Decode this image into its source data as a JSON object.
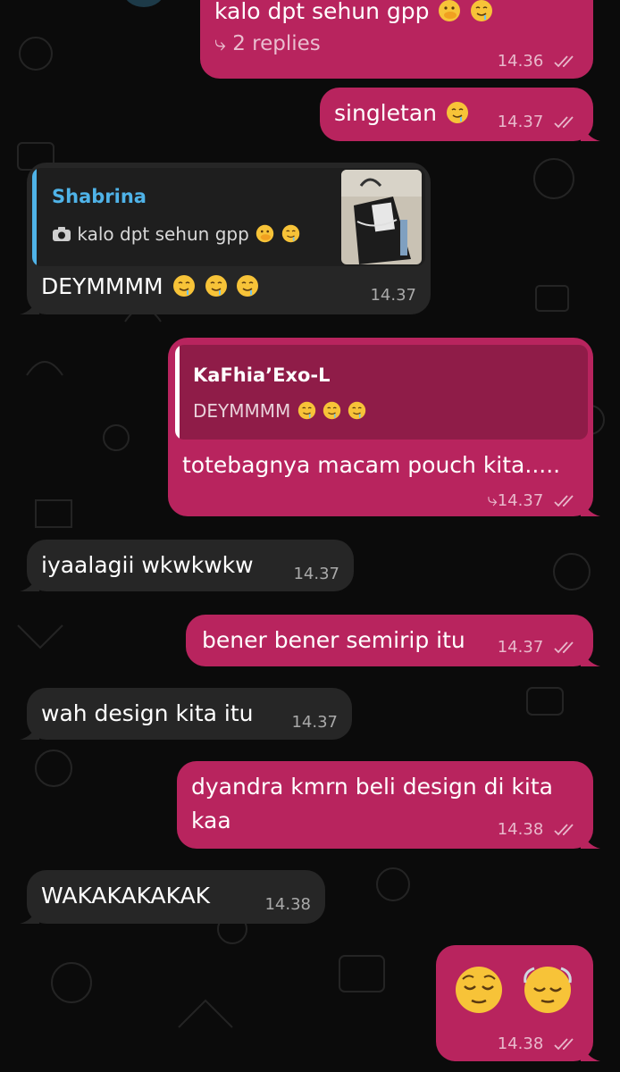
{
  "messages": [
    {
      "id": "m1",
      "direction": "out",
      "text": "kalo dpt sehun gpp",
      "replies_label": "2 replies",
      "time": "14.36",
      "ticks": "read-double-check"
    },
    {
      "id": "m2",
      "direction": "out",
      "text": "singletan",
      "time": "14.37",
      "ticks": "read-double-check"
    },
    {
      "id": "m3",
      "direction": "in",
      "reply_to": {
        "name": "Shabrina",
        "text": "kalo dpt sehun gpp"
      },
      "text": "DEYMMMM",
      "time": "14.37"
    },
    {
      "id": "m4",
      "direction": "out",
      "reply_to": {
        "name": "KaFhia’Exo-L",
        "text": "DEYMMMM"
      },
      "text": "totebagnya macam pouch kita.....",
      "time": "14.37",
      "ticks": "forward-reply"
    },
    {
      "id": "m5",
      "direction": "in",
      "text": "iyaalagii wkwkwkw",
      "time": "14.37"
    },
    {
      "id": "m6",
      "direction": "out",
      "text": "bener bener semirip itu",
      "time": "14.37",
      "ticks": "read-double-check"
    },
    {
      "id": "m7",
      "direction": "in",
      "text": "wah design kita itu",
      "time": "14.37"
    },
    {
      "id": "m8",
      "direction": "out",
      "text_line1": "dyandra kmrn beli design di kita",
      "text_line2": "kaa",
      "time": "14.38",
      "ticks": "read-double-check"
    },
    {
      "id": "m9",
      "direction": "in",
      "text": "WAKAKAKAKAK",
      "time": "14.38"
    },
    {
      "id": "m10",
      "direction": "out",
      "emojis": [
        "relieved-face",
        "relieved-face-with-dizzy"
      ],
      "time": "14.38",
      "ticks": "read-double-check"
    }
  ],
  "colors": {
    "outgoing": "#b8245e",
    "incoming": "#262626",
    "quote_in_bar": "#4fb3e8",
    "quote_out_bg": "#8f1c48",
    "background": "#0b0b0b"
  },
  "icons": [
    "reply-arrow-icon",
    "double-check-icon",
    "camera-icon",
    "forward-reply-icon",
    "drooling-face-emoji",
    "hand-over-mouth-emoji",
    "relieved-face-emoji"
  ]
}
